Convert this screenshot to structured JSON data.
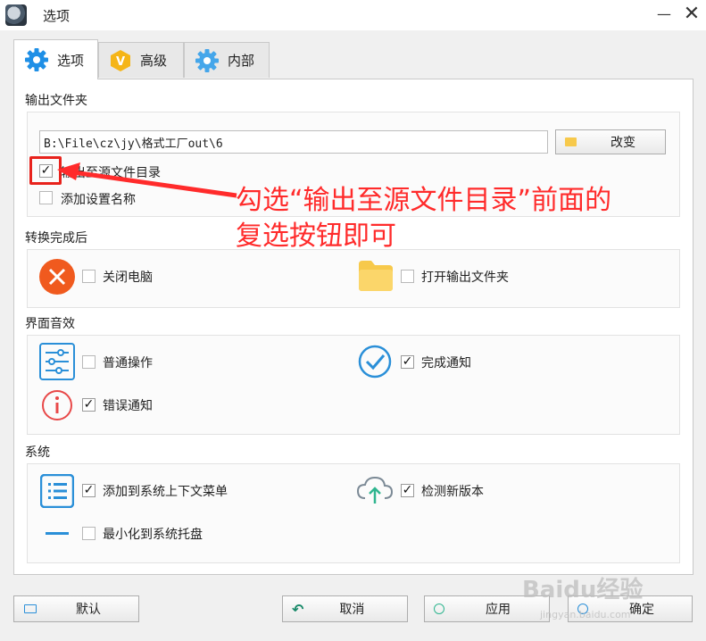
{
  "window": {
    "title": "选项",
    "minimize": "—",
    "close": "✕"
  },
  "tabs": [
    {
      "label": "选项",
      "icon": "gear-icon"
    },
    {
      "label": "高级",
      "icon": "hexagon-v-icon",
      "badge": "V"
    },
    {
      "label": "内部",
      "icon": "gear-icon"
    }
  ],
  "output": {
    "section_title": "输出文件夹",
    "path": "B:\\File\\cz\\jy\\格式工厂out\\6",
    "change_button": "改变",
    "to_source_label": "输出至源文件目录",
    "to_source_checked": true,
    "add_settings_name_label": "添加设置名称",
    "add_settings_name_checked": false
  },
  "after_convert": {
    "section_title": "转换完成后",
    "shutdown_label": "关闭电脑",
    "shutdown_checked": false,
    "open_folder_label": "打开输出文件夹",
    "open_folder_checked": false
  },
  "sound": {
    "section_title": "界面音效",
    "normal_label": "普通操作",
    "normal_checked": false,
    "complete_label": "完成通知",
    "complete_checked": true,
    "error_label": "错误通知",
    "error_checked": true
  },
  "system": {
    "section_title": "系统",
    "context_menu_label": "添加到系统上下文菜单",
    "context_menu_checked": true,
    "check_update_label": "检测新版本",
    "check_update_checked": true,
    "minimize_tray_label": "最小化到系统托盘",
    "minimize_tray_checked": false
  },
  "footer": {
    "default_label": "默认",
    "cancel_label": "取消",
    "apply_label": "应用",
    "ok_label": "确定"
  },
  "annotation": {
    "text_line1": "勾选“输出至源文件目录”前面的",
    "text_line2": "复选按钮即可",
    "color": "#ff2b2b"
  },
  "watermark": {
    "text": "Baidu经验",
    "sub": "jingyan.baidu.com"
  },
  "colors": {
    "accent_blue": "#1e8fe6",
    "shutdown_orange": "#f05a1e",
    "folder_yellow": "#f7c94b",
    "error_red": "#e84848",
    "check_blue": "#2a8fd8"
  }
}
